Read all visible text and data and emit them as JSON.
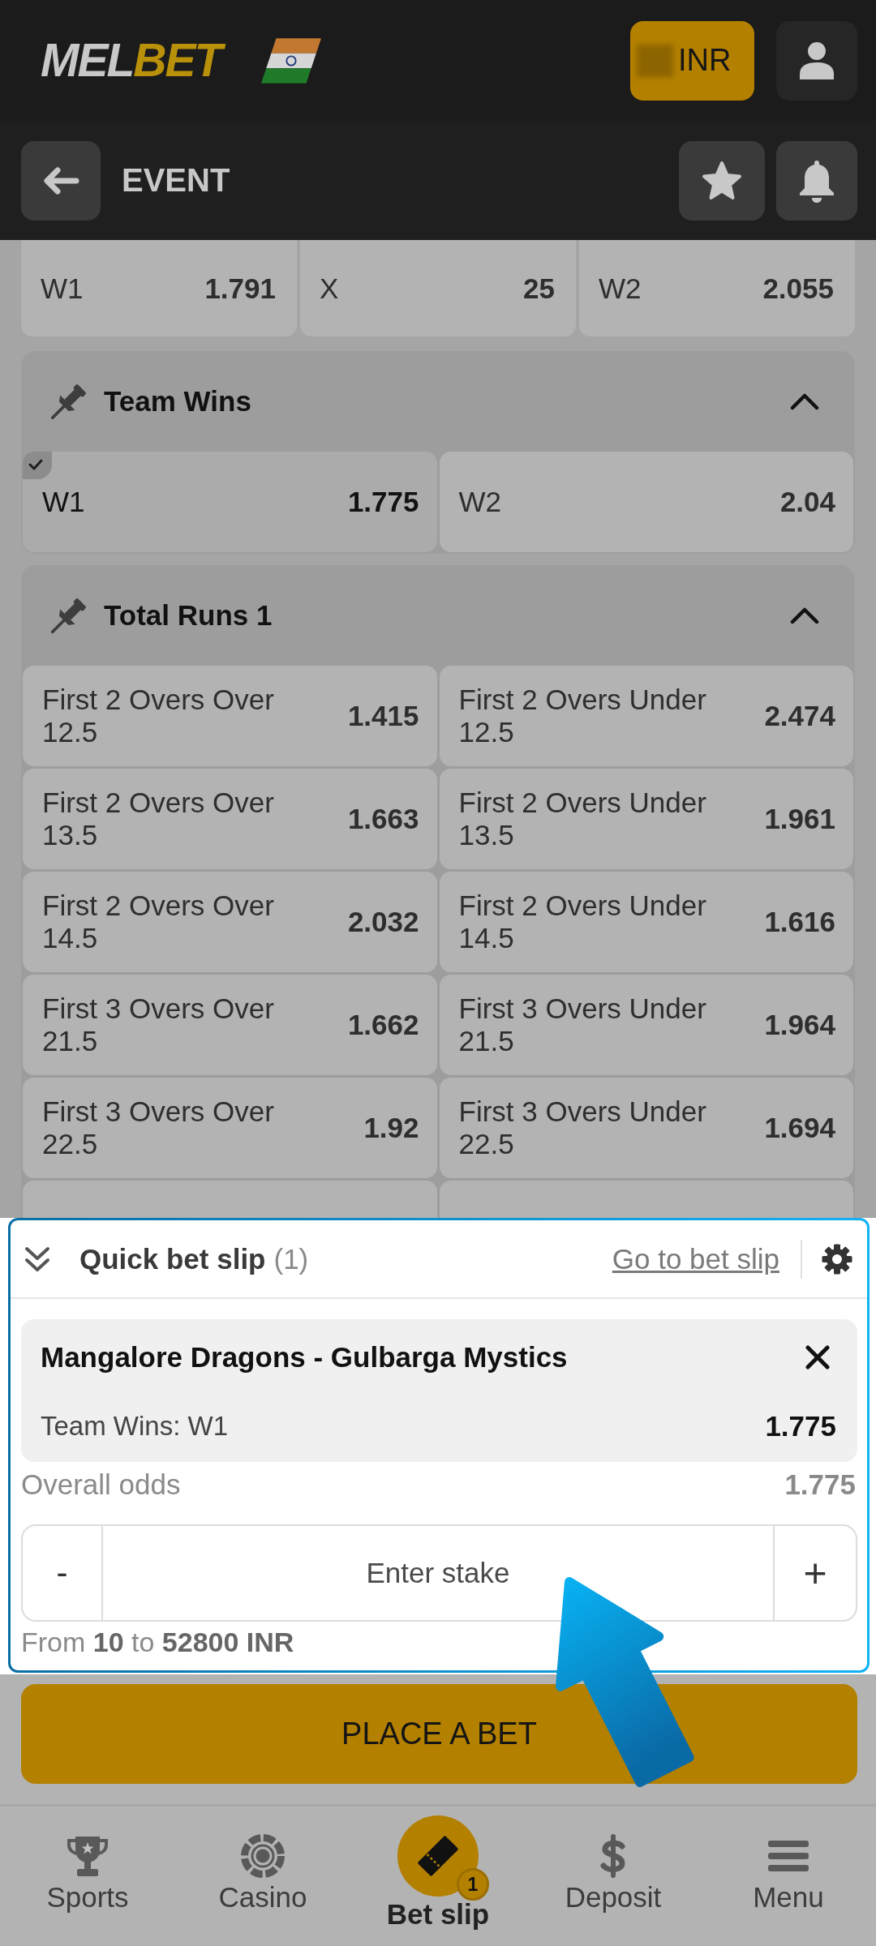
{
  "header": {
    "logo": [
      {
        "text": "MEL",
        "color": "#c8c8c8"
      },
      {
        "text": "BET",
        "color": "#b8900a"
      }
    ],
    "balance": {
      "amount_redacted": true,
      "currency": "INR"
    }
  },
  "event_bar": {
    "title": "EVENT"
  },
  "top_odds": [
    {
      "label": "W1",
      "odds": "1.791",
      "selected": false
    },
    {
      "label": "X",
      "odds": "25",
      "selected": false
    },
    {
      "label": "W2",
      "odds": "2.055",
      "selected": false
    }
  ],
  "markets": [
    {
      "title": "Team Wins",
      "expanded": true,
      "options": [
        {
          "label": "W1",
          "odds": "1.775",
          "selected": true
        },
        {
          "label": "W2",
          "odds": "2.04",
          "selected": false
        }
      ]
    },
    {
      "title": "Total Runs 1",
      "expanded": true,
      "more_below": true,
      "options": [
        {
          "label": "First 2 Overs Over 12.5",
          "odds": "1.415",
          "selected": false
        },
        {
          "label": "First 2 Overs Under 12.5",
          "odds": "2.474",
          "selected": false
        },
        {
          "label": "First 2 Overs Over 13.5",
          "odds": "1.663",
          "selected": false
        },
        {
          "label": "First 2 Overs Under 13.5",
          "odds": "1.961",
          "selected": false
        },
        {
          "label": "First 2 Overs Over 14.5",
          "odds": "2.032",
          "selected": false
        },
        {
          "label": "First 2 Overs Under 14.5",
          "odds": "1.616",
          "selected": false
        },
        {
          "label": "First 3 Overs Over 21.5",
          "odds": "1.662",
          "selected": false
        },
        {
          "label": "First 3 Overs Under 21.5",
          "odds": "1.964",
          "selected": false
        },
        {
          "label": "First 3 Overs Over 22.5",
          "odds": "1.92",
          "selected": false
        },
        {
          "label": "First 3 Overs Under 22.5",
          "odds": "1.694",
          "selected": false
        }
      ]
    }
  ],
  "quick_bet_slip": {
    "highlighted": true,
    "title": "Quick bet slip",
    "count": "(1)",
    "link": "Go to bet slip",
    "bets": [
      {
        "event": "Mangalore Dragons - Gulbarga Mystics",
        "market": "Team Wins: W1",
        "odds": "1.775"
      }
    ],
    "overall_label": "Overall odds",
    "overall_odds": "1.775",
    "stake": {
      "decrement": "-",
      "placeholder": "Enter stake",
      "increment": "+"
    },
    "limits": "From **10** to **52800 INR**"
  },
  "place_bet_button": "PLACE A BET",
  "bottom_nav": [
    {
      "label": "Sports",
      "kind": "trophy",
      "selected": false
    },
    {
      "label": "Casino",
      "kind": "chip",
      "selected": false
    },
    {
      "label": "Bet slip",
      "kind": "ticket",
      "selected": true,
      "badge": "1"
    },
    {
      "label": "Deposit",
      "kind": "dollar",
      "selected": false
    },
    {
      "label": "Menu",
      "kind": "bars",
      "selected": false
    }
  ],
  "annotation": {
    "kind": "arrow"
  }
}
